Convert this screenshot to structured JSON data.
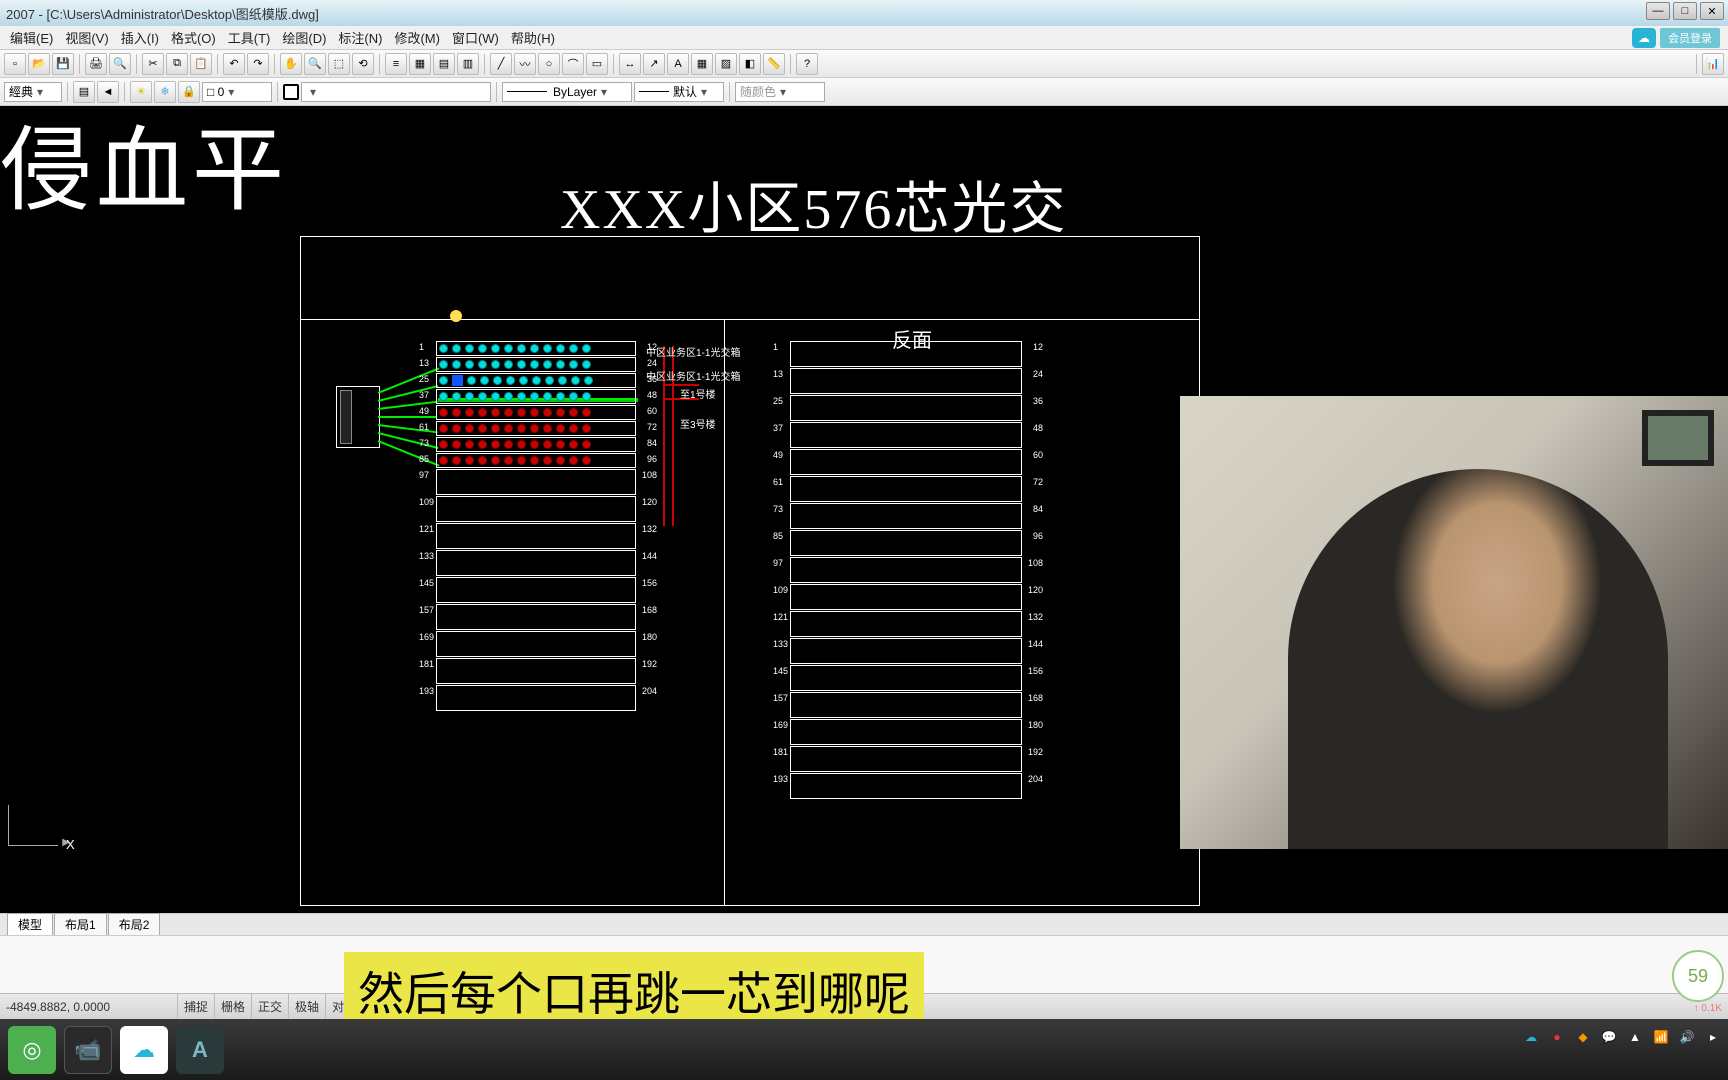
{
  "title": "2007 - [C:\\Users\\Administrator\\Desktop\\图纸模版.dwg]",
  "menus": [
    "编辑(E)",
    "视图(V)",
    "插入(I)",
    "格式(O)",
    "工具(T)",
    "绘图(D)",
    "标注(N)",
    "修改(M)",
    "窗口(W)",
    "帮助(H)"
  ],
  "toolbar2": {
    "style": "經典",
    "layer": "□ 0",
    "bylayer": "ByLayer",
    "linetype_scale": "默认",
    "color": "随颜色"
  },
  "cloud_label": "会员登录",
  "canvas": {
    "big_text": "侵血平",
    "draw_title": "XXX小区576芯光交",
    "back_label": "反面",
    "side_labels": [
      "中区业务区1-1光交箱",
      "中区业务区1-1光交箱",
      "至1号楼",
      "至3号楼"
    ],
    "front_rows_left": [
      "1",
      "13",
      "25",
      "37",
      "49",
      "61",
      "73",
      "85",
      "97",
      "109",
      "121",
      "133",
      "145",
      "157",
      "169",
      "181",
      "193"
    ],
    "front_rows_right": [
      "12",
      "24",
      "36",
      "48",
      "60",
      "72",
      "84",
      "96",
      "108",
      "120",
      "132",
      "144",
      "156",
      "168",
      "180",
      "192",
      "204"
    ],
    "ucs": "X"
  },
  "model_tabs": [
    "模型",
    "布局1",
    "布局2"
  ],
  "status": {
    "coord": "-4849.8882,  0.0000",
    "buttons": [
      "捕捉",
      "栅格",
      "正交",
      "极轴",
      "对象捕捉"
    ]
  },
  "subtitle": "然后每个口再跳一芯到哪呢",
  "circle_value": "59",
  "badge_sub": "↑ 0.1K",
  "tray_time_placeholder": ""
}
